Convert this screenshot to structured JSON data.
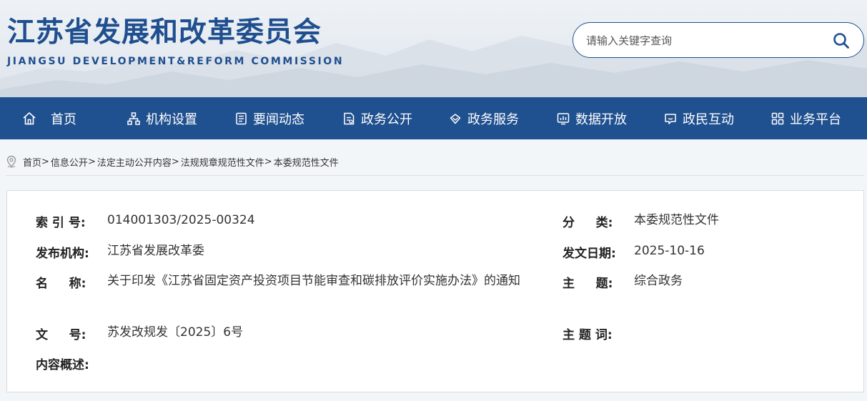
{
  "header": {
    "title": "江苏省发展和改革委员会",
    "subtitle": "JIANGSU DEVELOPMENT&REFORM COMMISSION"
  },
  "search": {
    "placeholder": "请输入关键字查询",
    "icon": "search-icon"
  },
  "nav": [
    {
      "label": "首页",
      "icon": "home-icon"
    },
    {
      "label": "机构设置",
      "icon": "org-chart-icon"
    },
    {
      "label": "要闻动态",
      "icon": "news-icon"
    },
    {
      "label": "政务公开",
      "icon": "document-icon"
    },
    {
      "label": "政务服务",
      "icon": "hands-icon"
    },
    {
      "label": "数据开放",
      "icon": "data-chart-icon"
    },
    {
      "label": "政民互动",
      "icon": "chat-icon"
    },
    {
      "label": "业务平台",
      "icon": "grid-icon"
    }
  ],
  "breadcrumb": {
    "icon": "location-pin-icon",
    "items": [
      "首页",
      "信息公开",
      "法定主动公开内容",
      "法规规章规范性文件",
      "本委规范性文件"
    ],
    "separator": ">"
  },
  "info": {
    "index_label": "索 引 号:",
    "index_value": "014001303/2025-00324",
    "category_label": "分     类:",
    "category_value": "本委规范性文件",
    "publisher_label": "发布机构:",
    "publisher_value": "江苏省发展改革委",
    "date_label": "发文日期:",
    "date_value": "2025-10-16",
    "name_label": "名     称:",
    "name_value": "关于印发《江苏省固定资产投资项目节能审查和碳排放评价实施办法》的通知",
    "topic_label": "主     题:",
    "topic_value": "综合政务",
    "docno_label": "文     号:",
    "docno_value": "苏发改规发〔2025〕6号",
    "keywords_label": "主 题 词:",
    "keywords_value": "",
    "summary_label": "内容概述:",
    "summary_value": ""
  },
  "colors": {
    "brand": "#1f508f",
    "title": "#1f4f8f",
    "page_bg": "#f3f6f9"
  }
}
